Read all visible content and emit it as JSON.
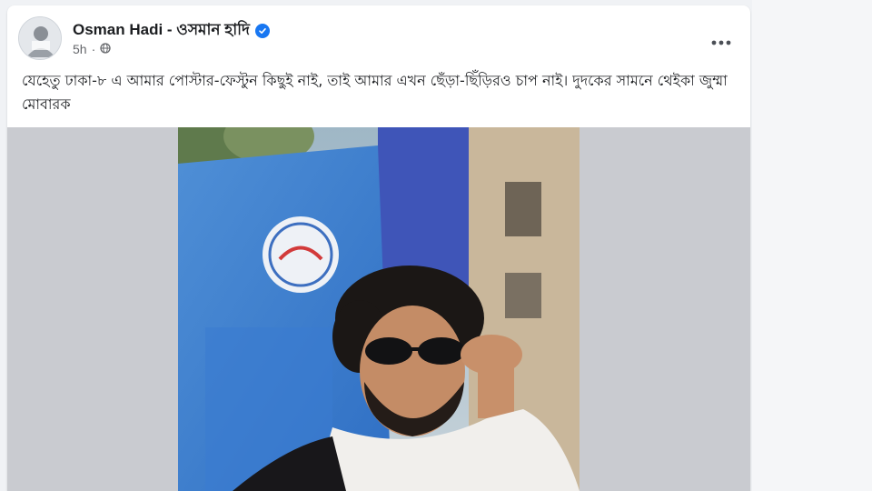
{
  "post": {
    "author_name": "Osman Hadi - ওসমান হাদি",
    "verified": true,
    "time": "5h",
    "audience_icon": "globe-icon",
    "more_icon": "more-options-icon",
    "text": "যেহেতু ঢাকা-৮ এ আমার পোস্টার-ফেস্টুন কিছুই নাই, তাই আমার এখন ছেঁড়া-ছিঁড়িরও চাপ নাই। দুদকের সামনে থেইকা জুম্মা মোবারক"
  },
  "colors": {
    "verified_badge": "#1877f2",
    "secondary_text": "#65676b",
    "primary_text": "#1c1e21",
    "card_bg": "#ffffff",
    "media_bg": "#c9cbd0"
  }
}
